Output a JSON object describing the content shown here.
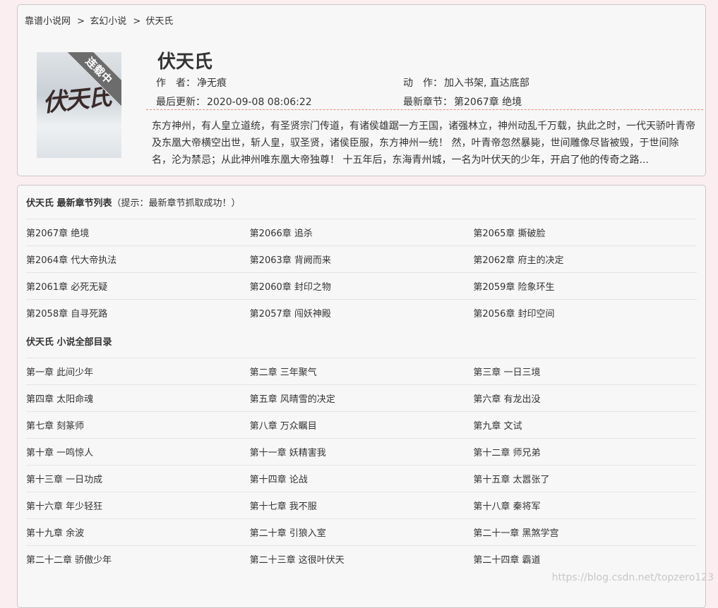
{
  "breadcrumb": {
    "site": "靠谱小说网",
    "category": "玄幻小说",
    "book": "伏天氏",
    "sep1": ">",
    "sep2": ">"
  },
  "book": {
    "title": "伏天氏",
    "status_ribbon": "连载中",
    "cover_title": "伏天氏",
    "author_label": "作　者：",
    "author": "净无痕",
    "actions_label": "动　作：",
    "action_bookshelf": "加入书架",
    "action_comma": ",",
    "action_bottom": "直达底部",
    "updated_label": "最后更新：",
    "updated": "2020-09-08 08:06:22",
    "latest_label": "最新章节：",
    "latest": "第2067章 绝境",
    "intro": "东方神州，有人皇立道统，有圣贤宗门传道，有诸侯雄踞一方王国，诸强林立，神州动乱千万载，执此之时，一代天骄叶青帝及东凰大帝横空出世，斩人皇，驭圣贤，诸侯臣服，东方神州一统！ 然，叶青帝忽然暴毙，世间雕像尽皆被毁，于世间除名，沦为禁忌；从此神州唯东凰大帝独尊！ 十五年后，东海青州城，一名为叶伏天的少年，开启了他的传奇之路..."
  },
  "latest_section": {
    "title_bold": "伏天氏 最新章节列表",
    "hint": "（提示：最新章节抓取成功！）",
    "rows": [
      [
        "第2067章 绝境",
        "第2066章 追杀",
        "第2065章 撕破脸"
      ],
      [
        "第2064章 代大帝执法",
        "第2063章 背阙而来",
        "第2062章 府主的决定"
      ],
      [
        "第2061章 必死无疑",
        "第2060章 封印之物",
        "第2059章 险象环生"
      ],
      [
        "第2058章 自寻死路",
        "第2057章 闯妖神殿",
        "第2056章 封印空间"
      ]
    ]
  },
  "all_section": {
    "title_bold": "伏天氏 小说全部目录",
    "rows": [
      [
        "第一章 此间少年",
        "第二章 三年聚气",
        "第三章 一日三境"
      ],
      [
        "第四章 太阳命魂",
        "第五章 风晴雪的决定",
        "第六章 有龙出没"
      ],
      [
        "第七章 刻篆师",
        "第八章 万众瞩目",
        "第九章 文试"
      ],
      [
        "第十章 一鸣惊人",
        "第十一章 妖精害我",
        "第十二章 师兄弟"
      ],
      [
        "第十三章 一日功成",
        "第十四章 论战",
        "第十五章 太嚣张了"
      ],
      [
        "第十六章 年少轻狂",
        "第十七章 我不服",
        "第十八章 秦将军"
      ],
      [
        "第十九章 余波",
        "第二十章 引狼入室",
        "第二十一章 黑煞学宫"
      ],
      [
        "第二十二章 骄傲少年",
        "第二十三章 这很叶伏天",
        "第二十四章 霸道"
      ]
    ]
  },
  "watermark": "https://blog.csdn.net/topzero123"
}
